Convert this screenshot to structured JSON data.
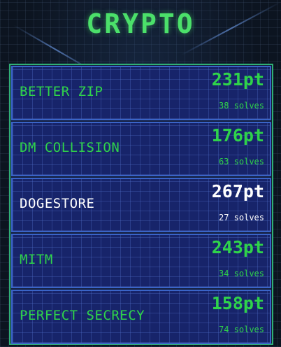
{
  "category": {
    "title": "CRYPTO"
  },
  "challenges": [
    {
      "name": "BETTER ZIP",
      "points": "231pt",
      "solves": "38 solves",
      "state": "unsolved"
    },
    {
      "name": "DM COLLISION",
      "points": "176pt",
      "solves": "63 solves",
      "state": "unsolved"
    },
    {
      "name": "DOGESTORE",
      "points": "267pt",
      "solves": "27 solves",
      "state": "selected"
    },
    {
      "name": "MITM",
      "points": "243pt",
      "solves": "34 solves",
      "state": "unsolved"
    },
    {
      "name": "PERFECT SECRECY",
      "points": "158pt",
      "solves": "74 solves",
      "state": "unsolved"
    }
  ],
  "colors": {
    "accent": "#2fd34a",
    "highlight": "#ffffff",
    "card_border": "#3a64c8",
    "frame": "#2fae75"
  }
}
